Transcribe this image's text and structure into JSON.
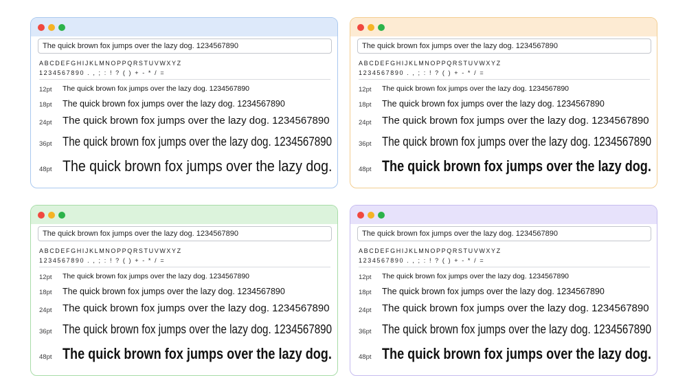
{
  "windows": [
    {
      "field_value": "The quick brown fox jumps over the lazy dog. 1234567890",
      "charset_upper": "ABCDEFGHIJKLMNOPPQRSTUVWXYZ",
      "charset_symbols": "1234567890 . , ; : ! ? ( ) + - * / =",
      "rows": [
        {
          "size": "12pt",
          "text": "The quick brown fox jumps over the lazy dog. 1234567890"
        },
        {
          "size": "18pt",
          "text": "The quick brown fox jumps over the lazy dog. 1234567890"
        },
        {
          "size": "24pt",
          "text": "The quick brown fox jumps over the lazy dog. 1234567890"
        },
        {
          "size": "36pt",
          "text": "The quick brown fox jumps over the lazy dog. 1234567890"
        },
        {
          "size": "48pt",
          "text": "The quick brown fox jumps over the lazy dog."
        }
      ]
    },
    {
      "field_value": "The quick brown fox jumps over the lazy dog. 1234567890",
      "charset_upper": "ABCDEFGHIJKLMNOPPQRSTUVWXYZ",
      "charset_symbols": "1234567890 . , ; : ! ? ( ) + - * / =",
      "rows": [
        {
          "size": "12pt",
          "text": "The quick brown fox jumps over the lazy dog. 1234567890"
        },
        {
          "size": "18pt",
          "text": "The quick brown fox jumps over the lazy dog. 1234567890"
        },
        {
          "size": "24pt",
          "text": "The quick brown fox jumps over the lazy dog. 1234567890"
        },
        {
          "size": "36pt",
          "text": "The quick brown fox jumps over the lazy dog. 1234567890"
        },
        {
          "size": "48pt",
          "text": "The quick brown fox jumps over the lazy dog."
        }
      ]
    },
    {
      "field_value": "The quick brown fox jumps over the lazy dog. 1234567890",
      "charset_upper": "ABCDEFGHIJKLMNOPPQRSTUVWXYZ",
      "charset_symbols": "1234567890 . , ; : ! ? ( ) + - * / =",
      "rows": [
        {
          "size": "12pt",
          "text": "The quick brown fox jumps over the lazy dog. 1234567890"
        },
        {
          "size": "18pt",
          "text": "The quick brown fox jumps over the lazy dog. 1234567890"
        },
        {
          "size": "24pt",
          "text": "The quick brown fox jumps over the lazy dog. 1234567890"
        },
        {
          "size": "36pt",
          "text": "The quick brown fox jumps over the lazy dog. 1234567890"
        },
        {
          "size": "48pt",
          "text": "The quick brown fox jumps over the lazy dog."
        }
      ]
    },
    {
      "field_value": "The quick brown fox jumps over the lazy dog. 1234567890",
      "charset_upper": "ABCDEFGHIJKLMNOPPQRSTUVWXYZ",
      "charset_symbols": "1234567890 . , ; : ! ? ( ) + - * / =",
      "rows": [
        {
          "size": "12pt",
          "text": "The quick brown fox jumps over the lazy dog. 1234567890"
        },
        {
          "size": "18pt",
          "text": "The quick brown fox jumps over the lazy dog. 1234567890"
        },
        {
          "size": "24pt",
          "text": "The quick brown fox jumps over the lazy dog. 1234567890"
        },
        {
          "size": "36pt",
          "text": "The quick brown fox jumps over the lazy dog. 1234567890"
        },
        {
          "size": "48pt",
          "text": "The quick brown fox jumps over the lazy dog."
        }
      ]
    }
  ],
  "colors": {
    "blue_window_titlebar": "#dde9fa",
    "blue_window_border": "#a9c8ef",
    "orange_window_titlebar": "#fdebd3",
    "orange_window_border": "#f3cd8f",
    "green_window_titlebar": "#dcf3dc",
    "green_window_border": "#a7dca7",
    "purple_window_titlebar": "#e7e2fb",
    "purple_window_border": "#c5bbef",
    "close_dot": "#f0483f",
    "minimize_dot": "#f5b325",
    "zoom_dot": "#2cb34a"
  }
}
